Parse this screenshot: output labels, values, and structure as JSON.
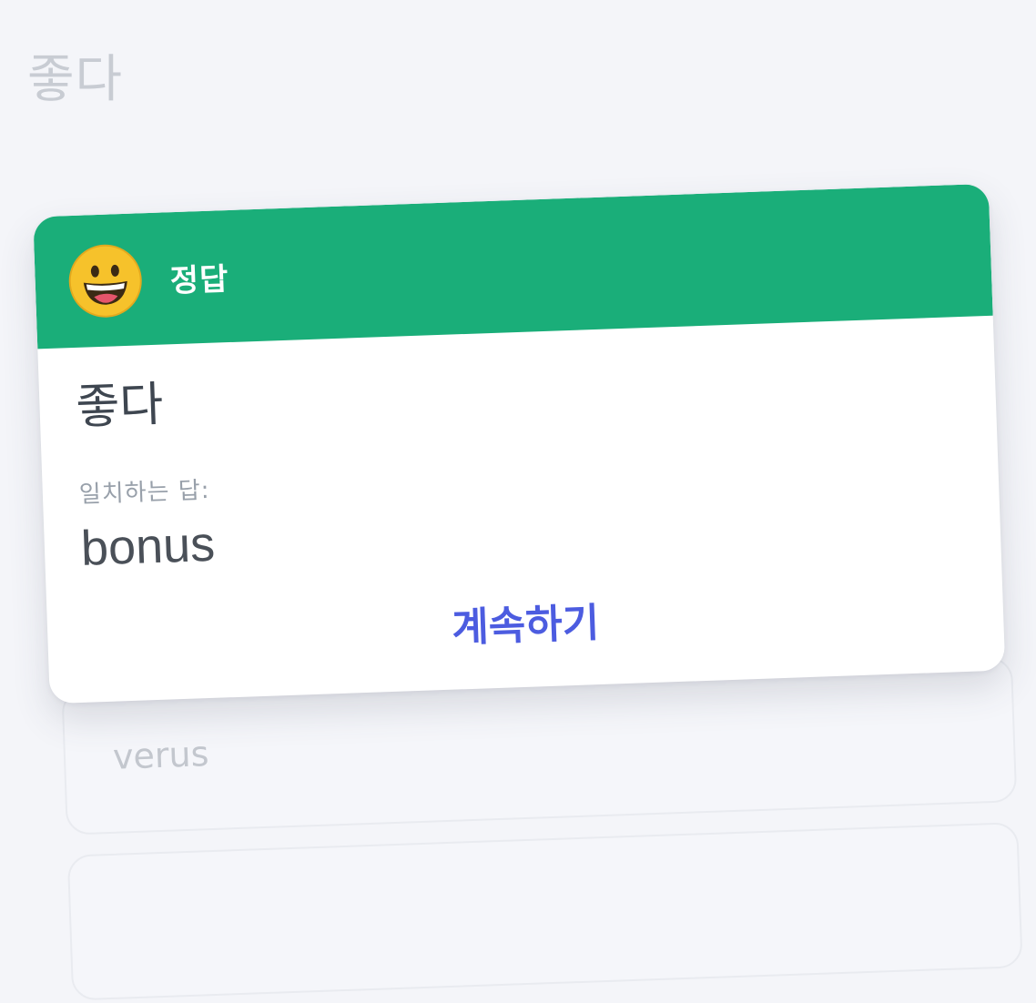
{
  "background": {
    "prompt_word": "좋다",
    "options": [
      "verus"
    ]
  },
  "feedback_card": {
    "status": "correct",
    "header_title": "정답",
    "emoji_icon": "grinning-face-icon",
    "header_color": "#1aae79",
    "answer_word": "좋다",
    "match_label": "일치하는 답:",
    "match_value": "bonus",
    "continue_label": "계속하기",
    "continue_color": "#4c5ce0"
  }
}
